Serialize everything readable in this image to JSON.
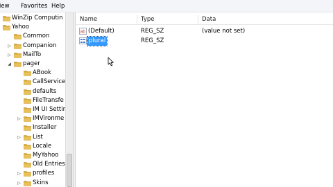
{
  "menu": {
    "view": "iew",
    "favorites": "Favorites",
    "help": "Help"
  },
  "tree": {
    "items": [
      {
        "label": "WinZip Computin",
        "expander": "",
        "level": 0
      },
      {
        "label": "Yahoo",
        "expander": "open",
        "level": 0
      },
      {
        "label": "Common",
        "expander": "",
        "level": 1
      },
      {
        "label": "Companion",
        "expander": "closed",
        "level": 1
      },
      {
        "label": "MailTo",
        "expander": "closed",
        "level": 1
      },
      {
        "label": "pager",
        "expander": "open",
        "level": 1
      },
      {
        "label": "ABook",
        "expander": "",
        "level": 2
      },
      {
        "label": "CallService",
        "expander": "",
        "level": 2
      },
      {
        "label": "defaults",
        "expander": "",
        "level": 2
      },
      {
        "label": "FileTransfe",
        "expander": "",
        "level": 2
      },
      {
        "label": "IM UI Settir",
        "expander": "",
        "level": 2
      },
      {
        "label": "IMVironme",
        "expander": "closed",
        "level": 2
      },
      {
        "label": "Installer",
        "expander": "",
        "level": 2
      },
      {
        "label": "List",
        "expander": "closed",
        "level": 2
      },
      {
        "label": "Locale",
        "expander": "",
        "level": 2
      },
      {
        "label": "MyYahoo",
        "expander": "",
        "level": 2
      },
      {
        "label": "Old Entries",
        "expander": "",
        "level": 2
      },
      {
        "label": "profiles",
        "expander": "closed",
        "level": 2
      },
      {
        "label": "Skins",
        "expander": "closed",
        "level": 2
      }
    ]
  },
  "list": {
    "headers": {
      "name": "Name",
      "type": "Type",
      "data": "Data"
    },
    "rows": [
      {
        "name": "(Default)",
        "type": "REG_SZ",
        "data": "(value not set)",
        "icon": "string-value-icon"
      },
      {
        "name": "plural",
        "type": "REG_SZ",
        "data": "",
        "icon": "binary-value-icon",
        "selected": true
      }
    ]
  },
  "colors": {
    "folder": "#e8c15a",
    "selection": "#3399ff"
  }
}
